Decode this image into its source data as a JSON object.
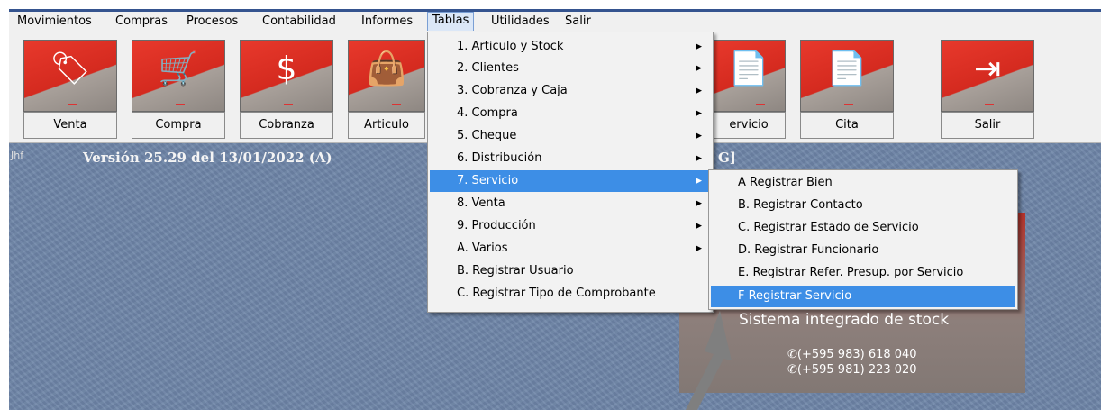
{
  "menubar": {
    "items": [
      "Movimientos",
      "Compras",
      "Procesos",
      "Contabilidad",
      "Informes",
      "Tablas",
      "Utilidades",
      "Salir"
    ],
    "active": "Tablas"
  },
  "toolbar": {
    "buttons": [
      {
        "label": "Venta",
        "icon": "price-tag-icon"
      },
      {
        "label": "Compra",
        "icon": "shopping-cart-icon"
      },
      {
        "label": "Cobranza",
        "icon": "money-hand-icon"
      },
      {
        "label": "Articulo",
        "icon": "article-bag-icon"
      },
      {
        "label": "ervicio",
        "icon": "service-document-icon"
      },
      {
        "label": "Cita",
        "icon": "appointment-document-icon"
      },
      {
        "label": "Salir",
        "icon": "exit-icon"
      }
    ]
  },
  "desktop": {
    "user": "Jhf",
    "version": "Versión 25.29 del 13/01/2022  (A)",
    "bracket": "G]",
    "splash_title": "Sistema integrado de stock",
    "phone1": "✆(+595 983) 618 040",
    "phone2": "✆(+595 981) 223 020"
  },
  "tablas_menu": [
    {
      "label": "1. Articulo y Stock",
      "submenu": true
    },
    {
      "label": "2. Clientes",
      "submenu": true
    },
    {
      "label": "3. Cobranza y Caja",
      "submenu": true
    },
    {
      "label": "4. Compra",
      "submenu": true
    },
    {
      "label": "5. Cheque",
      "submenu": true
    },
    {
      "label": "6. Distribución",
      "submenu": true
    },
    {
      "label": "7. Servicio",
      "submenu": true
    },
    {
      "label": "8. Venta",
      "submenu": true
    },
    {
      "label": "9. Producción",
      "submenu": true
    },
    {
      "label": "A. Varios",
      "submenu": true
    },
    {
      "label": "B. Registrar Usuario",
      "submenu": false
    },
    {
      "label": "C. Registrar Tipo de Comprobante",
      "submenu": false
    }
  ],
  "tablas_selected": "7. Servicio",
  "servicio_submenu": [
    "A  Registrar Bien",
    "B. Registrar Contacto",
    "C. Registrar Estado de Servicio",
    "D. Registrar Funcionario",
    "E. Registrar Refer. Presup. por Servicio",
    "F Registrar Servicio"
  ],
  "servicio_selected": "F Registrar Servicio",
  "colors": {
    "menu_highlight": "#3d8ee6",
    "tile_red": "#d42a1f",
    "desktop": "#6e85a8",
    "arrow": "#808080"
  }
}
